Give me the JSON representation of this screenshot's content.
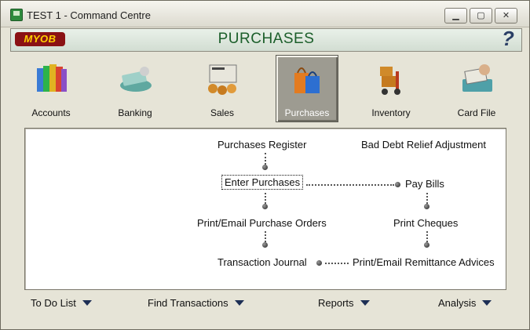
{
  "window": {
    "title": "TEST 1 - Command Centre"
  },
  "header": {
    "logo": "MYOB",
    "section_title": "PURCHASES"
  },
  "modules": [
    {
      "label": "Accounts"
    },
    {
      "label": "Banking"
    },
    {
      "label": "Sales"
    },
    {
      "label": "Purchases",
      "active": true
    },
    {
      "label": "Inventory"
    },
    {
      "label": "Card File"
    }
  ],
  "flow": {
    "purchases_register": "Purchases Register",
    "bad_debt_relief": "Bad Debt Relief Adjustment",
    "enter_purchases": "Enter Purchases",
    "pay_bills": "Pay Bills",
    "print_purchase_orders": "Print/Email Purchase Orders",
    "print_cheques": "Print Cheques",
    "transaction_journal": "Transaction Journal",
    "print_remittance": "Print/Email Remittance Advices"
  },
  "bottom": {
    "to_do_list": "To Do List",
    "find_transactions": "Find Transactions",
    "reports": "Reports",
    "analysis": "Analysis"
  },
  "colors": {
    "section_title": "#1b5e2a",
    "logo_bg": "#8a1214",
    "logo_text": "#ffd100"
  }
}
